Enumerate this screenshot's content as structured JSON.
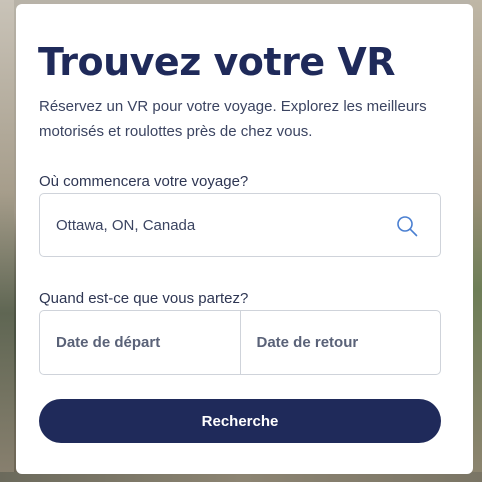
{
  "card": {
    "title": "Trouvez votre VR",
    "subtitle": "Réservez un VR pour votre voyage. Explorez les meilleurs motorisés et roulottes près de chez vous."
  },
  "location": {
    "label": "Où commencera votre voyage?",
    "value": "Ottawa, ON, Canada",
    "icon": "search-icon"
  },
  "dates": {
    "label": "Quand est-ce que vous partez?",
    "departure_label": "Date de départ",
    "return_label": "Date de retour"
  },
  "actions": {
    "search_button": "Recherche"
  },
  "colors": {
    "primary": "#1f2a5a",
    "icon": "#4a7fd1",
    "border": "#cfd3da"
  }
}
